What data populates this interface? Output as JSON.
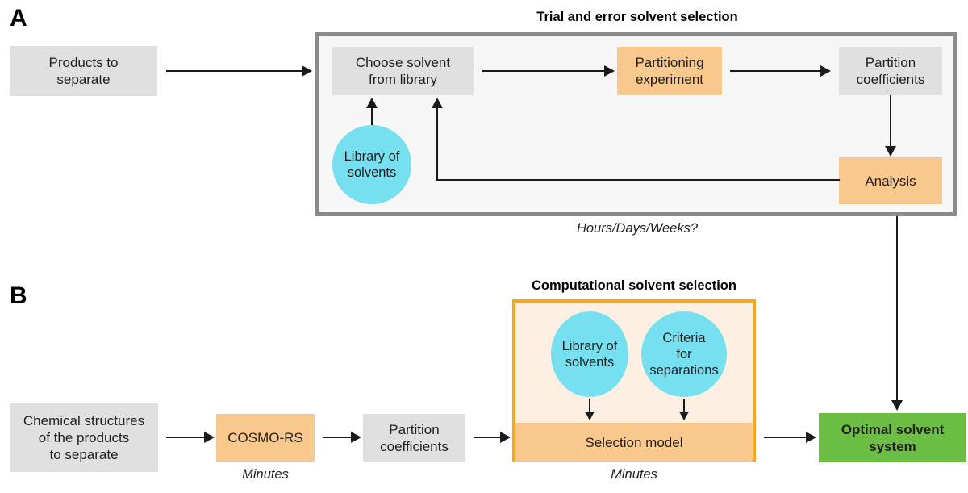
{
  "figure": {
    "panels": [
      {
        "letter": "A",
        "title": "Trial and error solvent selection",
        "caption": "Hours/Days/Weeks?",
        "nodes": {
          "products": "Products to\nseparate",
          "choose": "Choose solvent\nfrom library",
          "library": "Library of\nsolvents",
          "partitioning": "Partitioning\nexperiment",
          "coefficients": "Partition\ncoefficients",
          "analysis": "Analysis"
        }
      },
      {
        "letter": "B",
        "title": "Computational solvent selection",
        "caption_cosmo": "Minutes",
        "caption_box": "Minutes",
        "nodes": {
          "structures": "Chemical structures\nof the products\nto separate",
          "cosmo": "COSMO-RS",
          "coefficients": "Partition\ncoefficients",
          "library": "Library of\nsolvents",
          "criteria": "Criteria\nfor\nseparations",
          "selection_model": "Selection model",
          "optimal": "Optimal solvent\nsystem"
        }
      }
    ],
    "colors": {
      "gray_box": "#e0e0e0",
      "orange_box": "#f8c88c",
      "green_box": "#6cbe45",
      "cyan_circle": "#76dff0",
      "frame_gray": "#8b8b8b",
      "frame_orange": "#f5a623",
      "frame_gray_fill": "#f7f7f7",
      "frame_orange_fill": "#fdf0e2",
      "line": "#1a1a1a",
      "text": "#231f20"
    }
  }
}
